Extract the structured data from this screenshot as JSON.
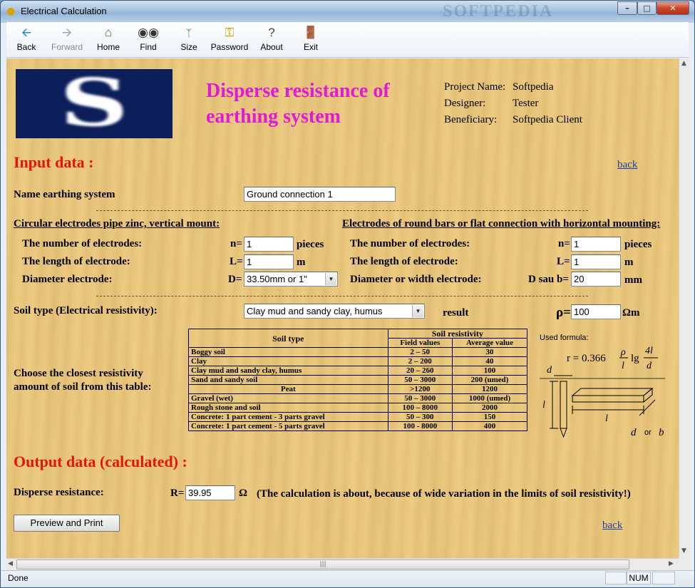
{
  "window": {
    "title": "Electrical Calculation",
    "watermark": "SOFTPEDIA"
  },
  "toolbar": {
    "back": "Back",
    "forward": "Forward",
    "home": "Home",
    "find": "Find",
    "size": "Size",
    "password": "Password",
    "about": "About",
    "exit": "Exit"
  },
  "header": {
    "title": "Disperse resistance of earthing system",
    "project_label": "Project Name:",
    "project_value": "Softpedia",
    "designer_label": "Designer:",
    "designer_value": "Tester",
    "beneficiary_label": "Beneficiary:",
    "beneficiary_value": "Softpedia Client"
  },
  "input": {
    "heading": "Input data :",
    "back_link": "back",
    "name_label": "Name earthing system",
    "name_value": "Ground connection 1",
    "vertical": {
      "heading": "Circular electrodes pipe zinc, vertical mount:",
      "count_label": "The number of electrodes:",
      "count_prefix": "n=",
      "count_value": "1",
      "count_unit": "pieces",
      "length_label": "The length of electrode:",
      "length_prefix": "L=",
      "length_value": "1",
      "length_unit": "m",
      "diameter_label": "Diameter electrode:",
      "diameter_prefix": "D=",
      "diameter_value": "33.50mm or 1\""
    },
    "horizontal": {
      "heading": "Electrodes of round bars or flat connection with horizontal mounting:",
      "count_label": "The number of electrodes:",
      "count_prefix": "n=",
      "count_value": "1",
      "count_unit": "pieces",
      "length_label": "The length of electrode:",
      "length_prefix": "L=",
      "length_value": "1",
      "length_unit": "m",
      "diameter_label": "Diameter or width electrode:",
      "diameter_prefix": "D sau b=",
      "diameter_value": "20",
      "diameter_unit": "mm"
    },
    "soil_label": "Soil type (Electrical resistivity):",
    "soil_value": "Clay mud and sandy clay, humus",
    "result_label": "result",
    "rho_prefix": "ρ=",
    "rho_value": "100",
    "rho_unit": "Ωm",
    "choose_text": "Choose the closest resistivity amount of soil from this table:"
  },
  "soil_table": {
    "col_type": "Soil type",
    "col_resistivity": "Soil resistivity",
    "col_field": "Field values",
    "col_avg": "Average value",
    "rows": [
      {
        "type": "Boggy soil",
        "field": "2 – 50",
        "avg": "30"
      },
      {
        "type": "Clay",
        "field": "2 – 200",
        "avg": "40"
      },
      {
        "type": "Clay mud and sandy clay, humus",
        "field": "20 – 260",
        "avg": "100"
      },
      {
        "type": "Sand and sandy soil",
        "field": "50 – 3000",
        "avg": "200 (umed)"
      },
      {
        "type": "Peat",
        "field": ">1200",
        "avg": "1200"
      },
      {
        "type": "Gravel (wet)",
        "field": "50 – 3000",
        "avg": "1000 (umed)"
      },
      {
        "type": "Rough stone and soil",
        "field": "100 – 8000",
        "avg": "2000"
      },
      {
        "type": "Concrete: 1 part cement - 3 parts gravel",
        "field": "50 – 300",
        "avg": "150"
      },
      {
        "type": "Concrete: 1 part cement - 5 parts gravel",
        "field": "100 - 8000",
        "avg": "400"
      }
    ]
  },
  "formula": {
    "label": "Used formula:",
    "lhs": "r = 0.366",
    "rho": "ρ",
    "l": "l",
    "lg": "lg",
    "num": "4l",
    "den": "d",
    "d": "d",
    "b": "b",
    "or": "or"
  },
  "output": {
    "heading": "Output data (calculated) :",
    "resistance_label": "Disperse resistance:",
    "r_prefix": "R=",
    "r_value": "39.95",
    "r_unit": "Ω",
    "note": "(The calculation is about, because of wide variation in the limits of soil resistivity!)",
    "print_button": "Preview and Print",
    "back_link": "back"
  },
  "status": {
    "text": "Done",
    "num": "NUM"
  }
}
